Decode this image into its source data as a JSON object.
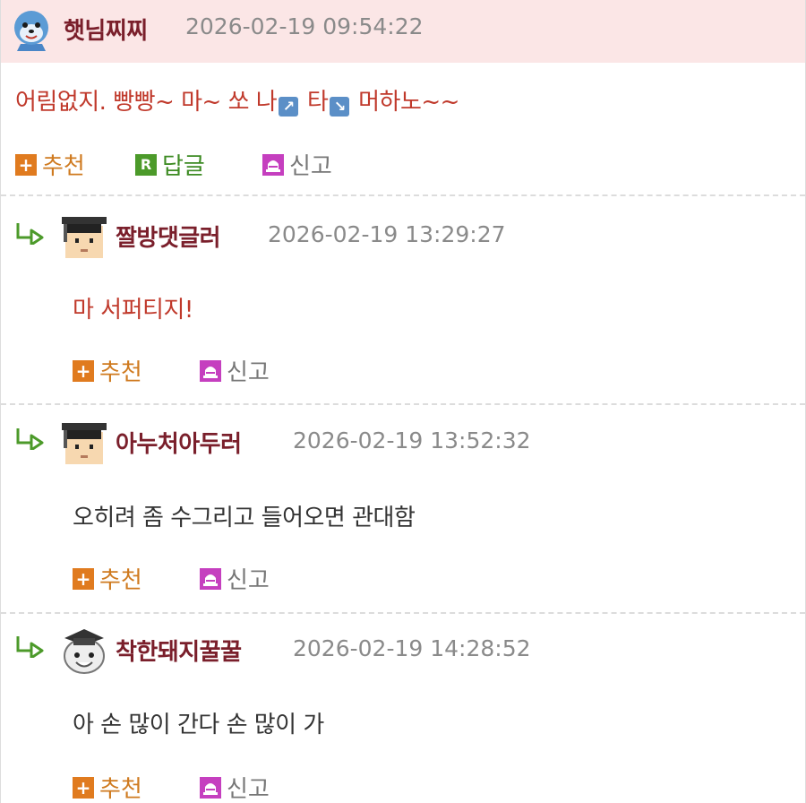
{
  "main_comment": {
    "nickname": "햇님찌찌",
    "datetime": "2026-02-19 09:54:22",
    "content_parts": [
      "어림없지. 빵빵~ 마~ 쏘 나",
      "타",
      "머하노~~"
    ],
    "icon1_glyph": "↗",
    "icon2_glyph": "↘",
    "actions": {
      "recommend": "추천",
      "reply": "답글",
      "report": "신고"
    },
    "reply_badge": "R"
  },
  "replies": [
    {
      "nickname": "짤방댓글러",
      "datetime": "2026-02-19 13:29:27",
      "content": "마 서퍼티지!",
      "recommend": "추천",
      "report": "신고"
    },
    {
      "nickname": "아누처아두러",
      "datetime": "2026-02-19 13:52:32",
      "content": "오히려 좀 수그리고 들어오면 관대함",
      "recommend": "추천",
      "report": "신고"
    },
    {
      "nickname": "착한돼지꿀꿀",
      "datetime": "2026-02-19 14:28:52",
      "content": "아 손 많이 간다 손 많이 가",
      "recommend": "추천",
      "report": "신고"
    }
  ],
  "icons": {
    "main_avatar": "seal-avatar-icon",
    "reply_arrow": "reply-arrow-icon",
    "recommend": "plus-icon",
    "reply": "reply-badge-icon",
    "report": "siren-icon"
  },
  "colors": {
    "header_bg": "#fbe6e6",
    "nickname": "#7a1f2b",
    "red_text": "#c0392b",
    "recommend": "#cf7a1f",
    "reply": "#3d8b23",
    "report_icon": "#c53fbf"
  }
}
